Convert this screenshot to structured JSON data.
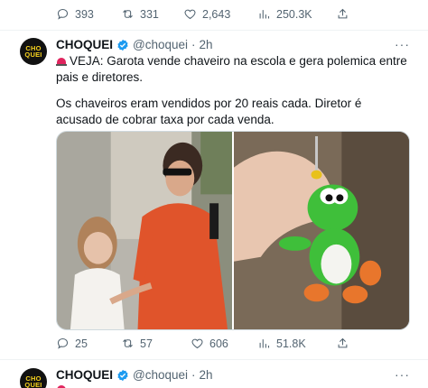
{
  "top_actions": {
    "replies": "393",
    "reposts": "331",
    "likes": "2,643",
    "views": "250.3K"
  },
  "tweet1": {
    "avatar_text_1": "CHO",
    "avatar_text_2": "QUEI",
    "name": "CHOQUEI",
    "handle": "@choquei",
    "dot": "·",
    "time": "2h",
    "more": "···",
    "line1": "VEJA: Garota vende chaveiro na escola e gera polemica entre pais e diretores.",
    "line2": "Os chaveiros eram vendidos por 20 reais cada. Diretor é acusado de cobrar taxa por cada venda.",
    "actions": {
      "replies": "25",
      "reposts": "57",
      "likes": "606",
      "views": "51.8K"
    }
  },
  "tweet2": {
    "avatar_text_1": "CHO",
    "avatar_text_2": "QUEI",
    "name": "CHOQUEI",
    "handle": "@choquei",
    "dot": "·",
    "time": "2h",
    "more": "···"
  },
  "colors": {
    "text": "#0f1419",
    "secondary": "#536471",
    "verified": "#1d9bf0",
    "siren": "#e0245e"
  }
}
